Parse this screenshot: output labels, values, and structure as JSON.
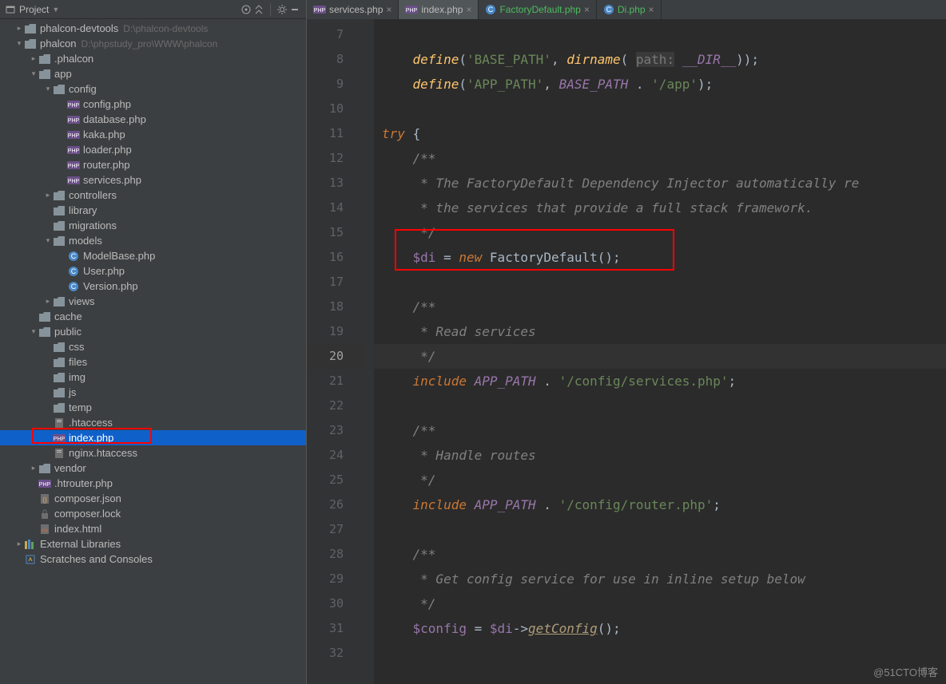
{
  "sidebar": {
    "title": "Project",
    "tree": [
      {
        "d": 0,
        "arrow": ">",
        "icon": "folder",
        "label": "phalcon-devtools",
        "hint": "D:\\phalcon-devtools"
      },
      {
        "d": 0,
        "arrow": "v",
        "icon": "folder",
        "label": "phalcon",
        "hint": "D:\\phpstudy_pro\\WWW\\phalcon"
      },
      {
        "d": 1,
        "arrow": ">",
        "icon": "folder",
        "label": ".phalcon"
      },
      {
        "d": 1,
        "arrow": "v",
        "icon": "folder",
        "label": "app"
      },
      {
        "d": 2,
        "arrow": "v",
        "icon": "folder",
        "label": "config"
      },
      {
        "d": 3,
        "arrow": "",
        "icon": "php",
        "label": "config.php"
      },
      {
        "d": 3,
        "arrow": "",
        "icon": "php",
        "label": "database.php"
      },
      {
        "d": 3,
        "arrow": "",
        "icon": "php",
        "label": "kaka.php"
      },
      {
        "d": 3,
        "arrow": "",
        "icon": "php",
        "label": "loader.php"
      },
      {
        "d": 3,
        "arrow": "",
        "icon": "php",
        "label": "router.php"
      },
      {
        "d": 3,
        "arrow": "",
        "icon": "php",
        "label": "services.php"
      },
      {
        "d": 2,
        "arrow": ">",
        "icon": "folder",
        "label": "controllers"
      },
      {
        "d": 2,
        "arrow": "",
        "icon": "folder",
        "label": "library"
      },
      {
        "d": 2,
        "arrow": "",
        "icon": "folder",
        "label": "migrations"
      },
      {
        "d": 2,
        "arrow": "v",
        "icon": "folder",
        "label": "models"
      },
      {
        "d": 3,
        "arrow": "",
        "icon": "class",
        "label": "ModelBase.php"
      },
      {
        "d": 3,
        "arrow": "",
        "icon": "class",
        "label": "User.php"
      },
      {
        "d": 3,
        "arrow": "",
        "icon": "class",
        "label": "Version.php"
      },
      {
        "d": 2,
        "arrow": ">",
        "icon": "folder",
        "label": "views"
      },
      {
        "d": 1,
        "arrow": "",
        "icon": "folder",
        "label": "cache"
      },
      {
        "d": 1,
        "arrow": "v",
        "icon": "folder",
        "label": "public"
      },
      {
        "d": 2,
        "arrow": "",
        "icon": "folder",
        "label": "css"
      },
      {
        "d": 2,
        "arrow": "",
        "icon": "folder",
        "label": "files"
      },
      {
        "d": 2,
        "arrow": "",
        "icon": "folder",
        "label": "img"
      },
      {
        "d": 2,
        "arrow": "",
        "icon": "folder",
        "label": "js"
      },
      {
        "d": 2,
        "arrow": "",
        "icon": "folder",
        "label": "temp"
      },
      {
        "d": 2,
        "arrow": "",
        "icon": "htaccess",
        "label": ".htaccess"
      },
      {
        "d": 2,
        "arrow": "",
        "icon": "php",
        "label": "index.php",
        "selected": true,
        "redbox": true
      },
      {
        "d": 2,
        "arrow": "",
        "icon": "htaccess",
        "label": "nginx.htaccess"
      },
      {
        "d": 1,
        "arrow": ">",
        "icon": "folder",
        "label": "vendor"
      },
      {
        "d": 1,
        "arrow": "",
        "icon": "php",
        "label": ".htrouter.php"
      },
      {
        "d": 1,
        "arrow": "",
        "icon": "json",
        "label": "composer.json"
      },
      {
        "d": 1,
        "arrow": "",
        "icon": "lock",
        "label": "composer.lock"
      },
      {
        "d": 1,
        "arrow": "",
        "icon": "html",
        "label": "index.html"
      },
      {
        "d": 0,
        "arrow": ">",
        "icon": "lib",
        "label": "External Libraries"
      },
      {
        "d": 0,
        "arrow": "",
        "icon": "scratch",
        "label": "Scratches and Consoles"
      }
    ]
  },
  "tabs": [
    {
      "icon": "php",
      "label": "services.php",
      "active": false
    },
    {
      "icon": "php",
      "label": "index.php",
      "active": true
    },
    {
      "icon": "class",
      "label": "FactoryDefault.php",
      "active": false,
      "green": true
    },
    {
      "icon": "class",
      "label": "Di.php",
      "active": false,
      "green": true
    }
  ],
  "code": {
    "start": 7,
    "highlight": 20,
    "lines": [
      [
        {
          "c": "plain",
          "t": "    "
        }
      ],
      [
        {
          "c": "plain",
          "t": "    "
        },
        {
          "c": "fn",
          "t": "define"
        },
        {
          "c": "plain",
          "t": "("
        },
        {
          "c": "str",
          "t": "'BASE_PATH'"
        },
        {
          "c": "plain",
          "t": ", "
        },
        {
          "c": "fn",
          "t": "dirname"
        },
        {
          "c": "plain",
          "t": "( "
        },
        {
          "c": "hint",
          "t": "path:"
        },
        {
          "c": "plain",
          "t": " "
        },
        {
          "c": "const",
          "t": "__DIR__"
        },
        {
          "c": "plain",
          "t": "));"
        }
      ],
      [
        {
          "c": "plain",
          "t": "    "
        },
        {
          "c": "fn",
          "t": "define"
        },
        {
          "c": "plain",
          "t": "("
        },
        {
          "c": "str",
          "t": "'APP_PATH'"
        },
        {
          "c": "plain",
          "t": ", "
        },
        {
          "c": "const",
          "t": "BASE_PATH"
        },
        {
          "c": "plain",
          "t": " . "
        },
        {
          "c": "str",
          "t": "'/app'"
        },
        {
          "c": "plain",
          "t": ");"
        }
      ],
      [],
      [
        {
          "c": "kw",
          "t": "try"
        },
        {
          "c": "plain",
          "t": " {"
        }
      ],
      [
        {
          "c": "plain",
          "t": "    "
        },
        {
          "c": "com",
          "t": "/**"
        }
      ],
      [
        {
          "c": "plain",
          "t": "    "
        },
        {
          "c": "com",
          "t": " * The FactoryDefault Dependency Injector automatically re"
        }
      ],
      [
        {
          "c": "plain",
          "t": "    "
        },
        {
          "c": "com",
          "t": " * the services that provide a full stack framework."
        }
      ],
      [
        {
          "c": "plain",
          "t": "    "
        },
        {
          "c": "com",
          "t": " */"
        }
      ],
      [
        {
          "c": "plain",
          "t": "    "
        },
        {
          "c": "var",
          "t": "$di"
        },
        {
          "c": "plain",
          "t": " = "
        },
        {
          "c": "kw",
          "t": "new"
        },
        {
          "c": "plain",
          "t": " FactoryDefault();"
        }
      ],
      [],
      [
        {
          "c": "plain",
          "t": "    "
        },
        {
          "c": "com",
          "t": "/**"
        }
      ],
      [
        {
          "c": "plain",
          "t": "    "
        },
        {
          "c": "com",
          "t": " * Read services"
        }
      ],
      [
        {
          "c": "plain",
          "t": "    "
        },
        {
          "c": "com",
          "t": " */"
        }
      ],
      [
        {
          "c": "plain",
          "t": "    "
        },
        {
          "c": "kw",
          "t": "include"
        },
        {
          "c": "plain",
          "t": " "
        },
        {
          "c": "const",
          "t": "APP_PATH"
        },
        {
          "c": "plain",
          "t": " . "
        },
        {
          "c": "str",
          "t": "'/config/services.php'"
        },
        {
          "c": "plain",
          "t": ";"
        }
      ],
      [],
      [
        {
          "c": "plain",
          "t": "    "
        },
        {
          "c": "com",
          "t": "/**"
        }
      ],
      [
        {
          "c": "plain",
          "t": "    "
        },
        {
          "c": "com",
          "t": " * Handle routes"
        }
      ],
      [
        {
          "c": "plain",
          "t": "    "
        },
        {
          "c": "com",
          "t": " */"
        }
      ],
      [
        {
          "c": "plain",
          "t": "    "
        },
        {
          "c": "kw",
          "t": "include"
        },
        {
          "c": "plain",
          "t": " "
        },
        {
          "c": "const",
          "t": "APP_PATH"
        },
        {
          "c": "plain",
          "t": " . "
        },
        {
          "c": "str",
          "t": "'/config/router.php'"
        },
        {
          "c": "plain",
          "t": ";"
        }
      ],
      [],
      [
        {
          "c": "plain",
          "t": "    "
        },
        {
          "c": "com",
          "t": "/**"
        }
      ],
      [
        {
          "c": "plain",
          "t": "    "
        },
        {
          "c": "com",
          "t": " * Get config service for use in inline setup below"
        }
      ],
      [
        {
          "c": "plain",
          "t": "    "
        },
        {
          "c": "com",
          "t": " */"
        }
      ],
      [
        {
          "c": "plain",
          "t": "    "
        },
        {
          "c": "var",
          "t": "$config"
        },
        {
          "c": "plain",
          "t": " = "
        },
        {
          "c": "var",
          "t": "$di"
        },
        {
          "c": "plain",
          "t": "->"
        },
        {
          "c": "call",
          "t": "getConfig"
        },
        {
          "c": "plain",
          "t": "();"
        }
      ],
      []
    ],
    "redbox_line": 16
  },
  "watermark": "@51CTO博客"
}
